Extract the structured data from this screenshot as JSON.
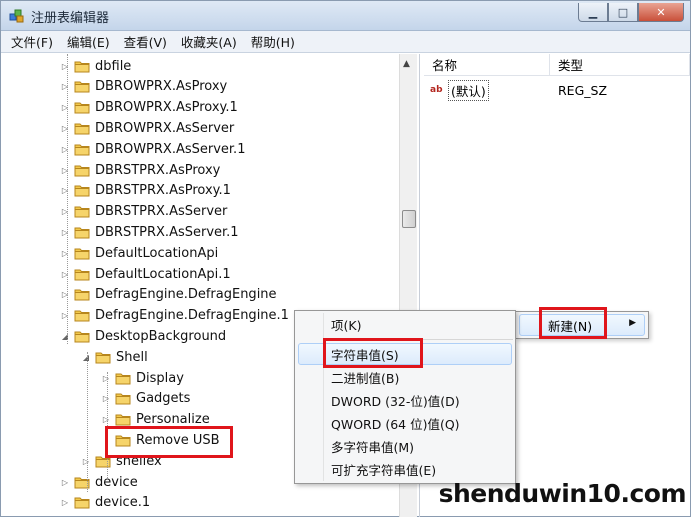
{
  "window": {
    "title": "注册表编辑器",
    "buttons": {
      "minimize": "▁",
      "maximize": "□",
      "close": "✕"
    }
  },
  "menubar": [
    "文件(F)",
    "编辑(E)",
    "查看(V)",
    "收藏夹(A)",
    "帮助(H)"
  ],
  "tree": [
    {
      "label": "dbfile",
      "expander": "▷"
    },
    {
      "label": "DBROWPRX.AsProxy",
      "expander": "▷"
    },
    {
      "label": "DBROWPRX.AsProxy.1",
      "expander": "▷"
    },
    {
      "label": "DBROWPRX.AsServer",
      "expander": "▷"
    },
    {
      "label": "DBROWPRX.AsServer.1",
      "expander": "▷"
    },
    {
      "label": "DBRSTPRX.AsProxy",
      "expander": "▷"
    },
    {
      "label": "DBRSTPRX.AsProxy.1",
      "expander": "▷"
    },
    {
      "label": "DBRSTPRX.AsServer",
      "expander": "▷"
    },
    {
      "label": "DBRSTPRX.AsServer.1",
      "expander": "▷"
    },
    {
      "label": "DefaultLocationApi",
      "expander": "▷"
    },
    {
      "label": "DefaultLocationApi.1",
      "expander": "▷"
    },
    {
      "label": "DefragEngine.DefragEngine",
      "expander": "▷"
    },
    {
      "label": "DefragEngine.DefragEngine.1",
      "expander": "▷"
    },
    {
      "label": "DesktopBackground",
      "expander": "◢"
    },
    {
      "label": "Shell",
      "expander": "◢"
    },
    {
      "label": "Display",
      "expander": "▷"
    },
    {
      "label": "Gadgets",
      "expander": "▷"
    },
    {
      "label": "Personalize",
      "expander": "▷"
    },
    {
      "label": "Remove USB",
      "expander": ""
    },
    {
      "label": "shellex",
      "expander": "▷"
    },
    {
      "label": "device",
      "expander": "▷"
    },
    {
      "label": "device.1",
      "expander": "▷"
    }
  ],
  "list": {
    "columns": {
      "name": "名称",
      "type": "类型"
    },
    "rows": [
      {
        "icon": "ab",
        "name": "(默认)",
        "type": "REG_SZ"
      }
    ]
  },
  "context_menu": {
    "items": [
      "项(K)",
      "字符串值(S)",
      "二进制值(B)",
      "DWORD (32-位)值(D)",
      "QWORD (64 位)值(Q)",
      "多字符串值(M)",
      "可扩充字符串值(E)"
    ],
    "highlighted": "字符串值(S)"
  },
  "new_menu": {
    "label": "新建(N)",
    "arrow": "▶"
  },
  "watermark": "shenduwin10.com",
  "colors": {
    "highlight_box": "#e0151b",
    "folder": "#e8b73a"
  }
}
